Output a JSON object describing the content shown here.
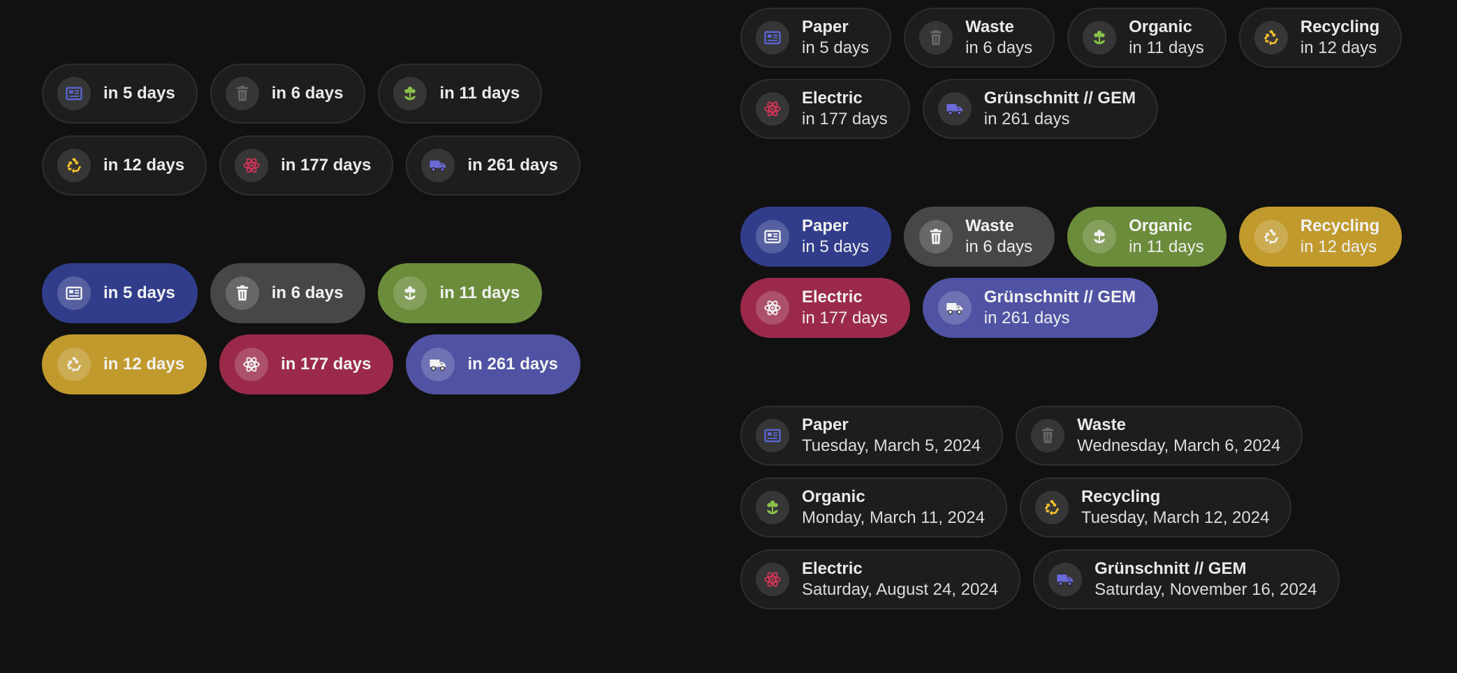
{
  "colors": {
    "paper": "#5b65d6",
    "waste": "#666666",
    "organic": "#8bc34a",
    "recycling": "#f6c22c",
    "electric": "#d03558",
    "gem": "#6a6ad8",
    "paper_bg": "#313d8b",
    "waste_bg": "#474747",
    "organic_bg": "#6b8c3a",
    "recycling_bg": "#c19a2d",
    "electric_bg": "#9b2a4a",
    "gem_bg": "#5053a3"
  },
  "icons": {
    "paper": "newspaper-icon",
    "waste": "trash-can-icon",
    "organic": "flower-icon",
    "recycling": "recycle-icon",
    "electric": "atom-icon",
    "gem": "truck-icon"
  },
  "compact_dark": [
    [
      {
        "type": "paper",
        "label": "in 5 days"
      },
      {
        "type": "waste",
        "label": "in 6 days"
      },
      {
        "type": "organic",
        "label": "in 11 days"
      }
    ],
    [
      {
        "type": "recycling",
        "label": "in 12 days"
      },
      {
        "type": "electric",
        "label": "in 177 days"
      },
      {
        "type": "gem",
        "label": "in 261 days"
      }
    ]
  ],
  "compact_colored": [
    [
      {
        "type": "paper",
        "label": "in 5 days"
      },
      {
        "type": "waste",
        "label": "in 6 days"
      },
      {
        "type": "organic",
        "label": "in 11 days"
      }
    ],
    [
      {
        "type": "recycling",
        "label": "in 12 days"
      },
      {
        "type": "electric",
        "label": "in 177 days"
      },
      {
        "type": "gem",
        "label": "in 261 days"
      }
    ]
  ],
  "named_dark": [
    [
      {
        "type": "paper",
        "name": "Paper",
        "sub": "in 5 days"
      },
      {
        "type": "waste",
        "name": "Waste",
        "sub": "in 6 days"
      },
      {
        "type": "organic",
        "name": "Organic",
        "sub": "in 11 days"
      },
      {
        "type": "recycling",
        "name": "Recycling",
        "sub": "in 12 days"
      }
    ],
    [
      {
        "type": "electric",
        "name": "Electric",
        "sub": "in 177 days"
      },
      {
        "type": "gem",
        "name": "Grünschnitt // GEM",
        "sub": "in 261 days"
      }
    ]
  ],
  "named_colored": [
    [
      {
        "type": "paper",
        "name": "Paper",
        "sub": "in 5 days"
      },
      {
        "type": "waste",
        "name": "Waste",
        "sub": "in 6 days"
      },
      {
        "type": "organic",
        "name": "Organic",
        "sub": "in 11 days"
      },
      {
        "type": "recycling",
        "name": "Recycling",
        "sub": "in 12 days"
      }
    ],
    [
      {
        "type": "electric",
        "name": "Electric",
        "sub": "in 177 days"
      },
      {
        "type": "gem",
        "name": "Grünschnitt // GEM",
        "sub": "in 261 days"
      }
    ]
  ],
  "named_dates": [
    [
      {
        "type": "paper",
        "name": "Paper",
        "sub": "Tuesday, March 5, 2024"
      },
      {
        "type": "waste",
        "name": "Waste",
        "sub": "Wednesday, March 6, 2024"
      }
    ],
    [
      {
        "type": "organic",
        "name": "Organic",
        "sub": "Monday, March 11, 2024"
      },
      {
        "type": "recycling",
        "name": "Recycling",
        "sub": "Tuesday, March 12, 2024"
      }
    ],
    [
      {
        "type": "electric",
        "name": "Electric",
        "sub": "Saturday, August 24, 2024"
      },
      {
        "type": "gem",
        "name": "Grünschnitt // GEM",
        "sub": "Saturday, November 16, 2024"
      }
    ]
  ]
}
